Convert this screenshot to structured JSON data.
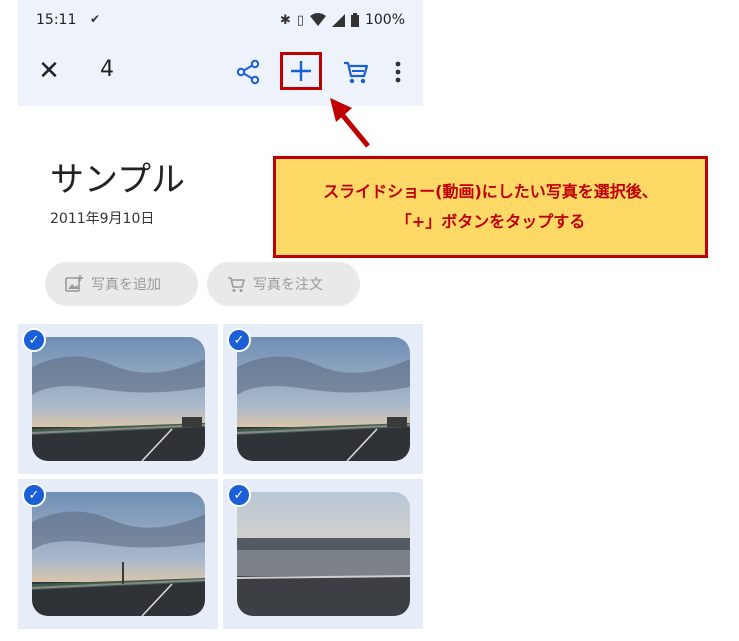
{
  "status_bar": {
    "time": "15:11",
    "battery": "100%",
    "icons": [
      "bluetooth-icon",
      "vibrate-icon",
      "wifi-icon",
      "signal-icon",
      "battery-icon"
    ]
  },
  "app_bar": {
    "selected_count": "4",
    "actions": [
      "close-icon",
      "share-icon",
      "add-icon",
      "cart-icon",
      "more-vert-icon"
    ]
  },
  "album": {
    "title": "サンプル",
    "date": "2011年9月10日"
  },
  "chips": {
    "add_photos": "写真を追加",
    "order_photos": "写真を注文"
  },
  "photos": [
    {
      "selected": true,
      "scene": "sunset-highway"
    },
    {
      "selected": true,
      "scene": "sunset-highway"
    },
    {
      "selected": true,
      "scene": "sunset-highway"
    },
    {
      "selected": true,
      "scene": "highway-guardrail"
    }
  ],
  "callout": {
    "line1": "スライドショー(動画)にしたい写真を選択後、",
    "line2": "「+」ボタンをタップする"
  },
  "colors": {
    "accent": "#1a5fd6",
    "highlight_border": "#c00000",
    "callout_fill": "#ffd966",
    "bar_background": "#eef2fb"
  }
}
